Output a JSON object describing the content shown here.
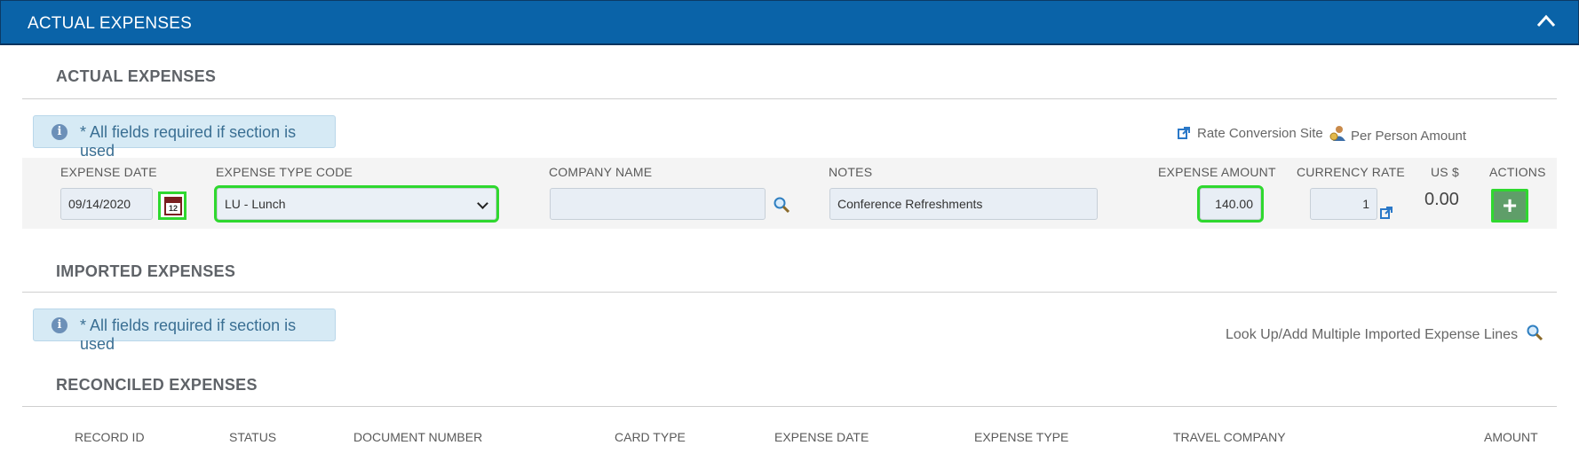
{
  "panel": {
    "title": "ACTUAL EXPENSES"
  },
  "actual": {
    "section_title": "ACTUAL EXPENSES",
    "info": "* All fields required if section is used",
    "links": {
      "rate_conversion": "Rate Conversion Site",
      "per_person": "Per Person Amount"
    },
    "labels": {
      "expense_date": "EXPENSE DATE",
      "expense_type_code": "EXPENSE TYPE CODE",
      "company_name": "COMPANY NAME",
      "notes": "NOTES",
      "expense_amount": "EXPENSE AMOUNT",
      "currency_rate": "CURRENCY RATE",
      "usd": "US $",
      "actions": "ACTIONS"
    },
    "values": {
      "expense_date": "09/14/2020",
      "calendar_day": "12",
      "expense_type_code": "LU - Lunch",
      "company_name": "",
      "notes": "Conference Refreshments",
      "expense_amount": "140.00",
      "currency_rate": "1",
      "usd": "0.00",
      "add": "+"
    }
  },
  "imported": {
    "section_title": "IMPORTED EXPENSES",
    "info": "* All fields required if section is used",
    "lookup_link": "Look Up/Add Multiple Imported Expense Lines"
  },
  "reconciled": {
    "section_title": "RECONCILED EXPENSES",
    "columns": [
      "RECORD ID",
      "STATUS",
      "DOCUMENT NUMBER",
      "CARD TYPE",
      "EXPENSE DATE",
      "EXPENSE TYPE",
      "TRAVEL COMPANY",
      "AMOUNT"
    ]
  },
  "colors": {
    "header_blue": "#0a63a8",
    "highlight_green": "#2fd82f",
    "add_button": "#5f9e69",
    "info_bg": "#d6eaf5"
  },
  "icons": [
    "chevron-up-icon",
    "info-icon",
    "external-link-icon",
    "person-coins-icon",
    "calendar-icon",
    "chevron-down-icon",
    "search-icon",
    "plus-icon"
  ]
}
